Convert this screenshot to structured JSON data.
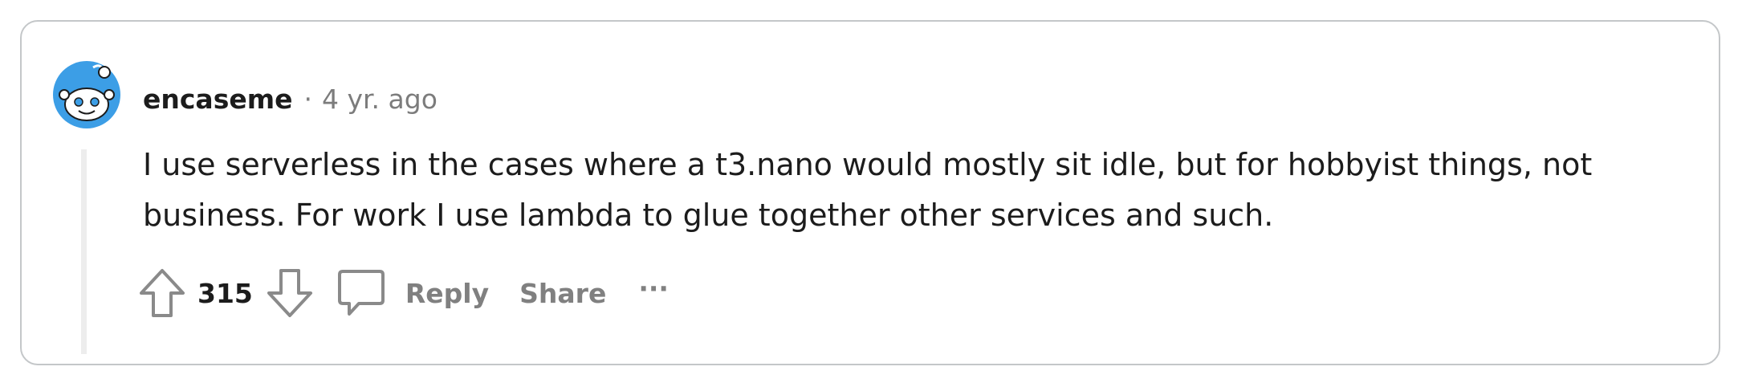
{
  "comment": {
    "username": "encaseme",
    "separator": "·",
    "timestamp": "4 yr. ago",
    "body_lines": [
      "I use serverless in the cases where a t3.nano would mostly sit idle, but for hobbyist things, not",
      "business. For work I use lambda to glue together other services and such."
    ]
  },
  "actions": {
    "vote_count": "315",
    "reply_label": "Reply",
    "share_label": "Share",
    "more_label": "···"
  },
  "colors": {
    "avatar_blue": "#3c9ee6",
    "text": "#1c1c1c",
    "muted": "#7c7c7c",
    "border": "#c4c7c9"
  }
}
